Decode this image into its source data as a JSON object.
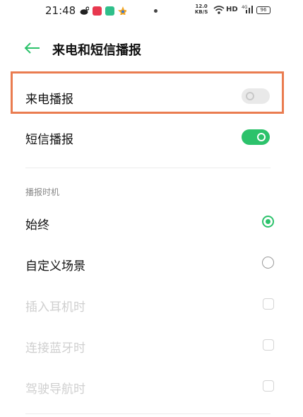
{
  "status_bar": {
    "time": "21:48",
    "net_speed_value": "12.0",
    "net_speed_unit": "KB/S",
    "hd_label": "HD",
    "signal_label": "4G",
    "battery_level": "96"
  },
  "header": {
    "title": "来电和短信播报"
  },
  "toggles": [
    {
      "label": "来电播报",
      "state": "off"
    },
    {
      "label": "短信播报",
      "state": "on"
    }
  ],
  "timing": {
    "section_label": "播报时机",
    "options": [
      {
        "label": "始终",
        "selected": true,
        "enabled": true
      },
      {
        "label": "自定义场景",
        "selected": false,
        "enabled": true
      },
      {
        "label": "插入耳机时",
        "selected": false,
        "enabled": false
      },
      {
        "label": "连接蓝牙时",
        "selected": false,
        "enabled": false
      },
      {
        "label": "驾驶导航时",
        "selected": false,
        "enabled": false
      }
    ]
  },
  "colors": {
    "accent": "#2cc26b",
    "highlight_border": "#ea7c50",
    "disabled_text": "#cfcfcf"
  }
}
